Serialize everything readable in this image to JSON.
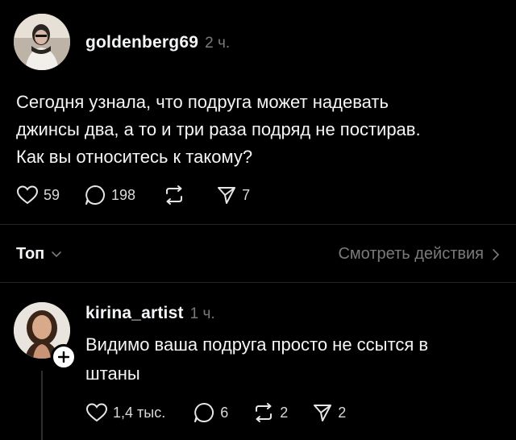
{
  "post": {
    "username": "goldenberg69",
    "time": "2 ч.",
    "text_lines": [
      "Сегодня узнала, что подруга может надевать",
      "джинсы два, а то и три раза подряд не постирав.",
      "Как вы относитесь к такому?"
    ],
    "likes": "59",
    "comments": "198",
    "shares": "7"
  },
  "sort_bar": {
    "sort_label": "Топ",
    "activity_link": "Смотреть действия"
  },
  "reply": {
    "username": "kirina_artist",
    "time": "1 ч.",
    "text_lines": [
      "Видимо ваша подруга просто не ссытся в",
      "штаны"
    ],
    "likes": "1,4 тыс.",
    "comments": "6",
    "reposts": "2",
    "shares": "2"
  },
  "icons": {
    "like": "heart-icon",
    "comment": "comment-bubble-icon",
    "repost": "repost-icon",
    "share": "send-icon",
    "sort_dropdown": "chevron-down-icon",
    "activity": "chevron-right-icon",
    "follow": "plus-icon"
  }
}
